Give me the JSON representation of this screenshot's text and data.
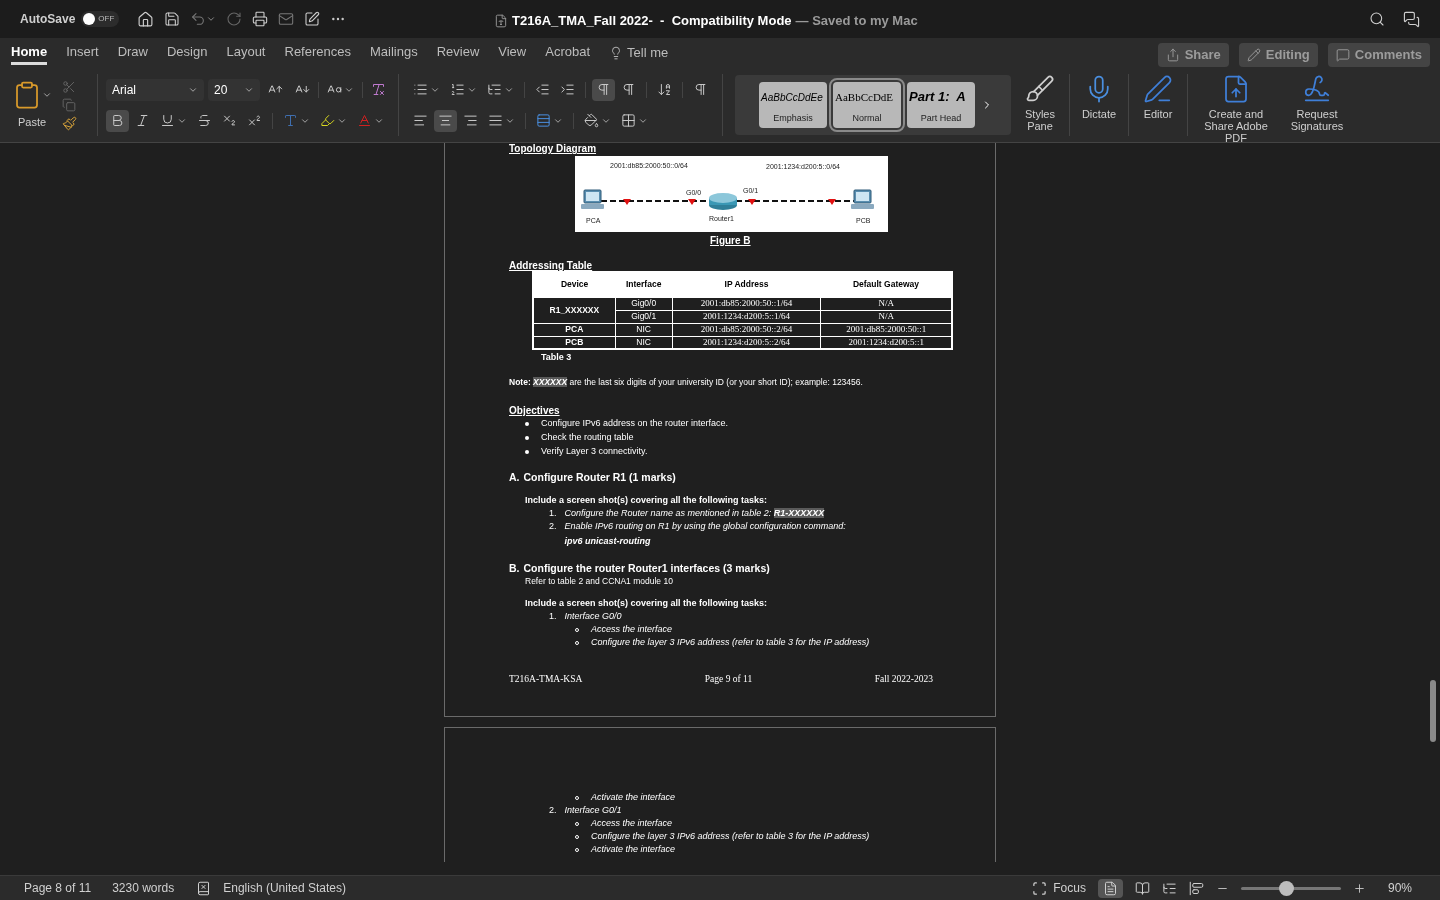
{
  "title_bar": {
    "autosave": {
      "label": "AutoSave",
      "on": false,
      "toggle_text": "OFF"
    },
    "title": "T216A_TMA_Fall 2022-  -  Compatibility Mode",
    "save_status": "— Saved to my Mac"
  },
  "ribbon_tabs": [
    {
      "label": "Home",
      "selected": true
    },
    {
      "label": "Insert",
      "selected": false
    },
    {
      "label": "Draw",
      "selected": false
    },
    {
      "label": "Design",
      "selected": false
    },
    {
      "label": "Layout",
      "selected": false
    },
    {
      "label": "References",
      "selected": false
    },
    {
      "label": "Mailings",
      "selected": false
    },
    {
      "label": "Review",
      "selected": false
    },
    {
      "label": "View",
      "selected": false
    },
    {
      "label": "Acrobat",
      "selected": false
    }
  ],
  "tell_me": "Tell me",
  "header_buttons": [
    "Share",
    "Editing",
    "Comments"
  ],
  "ribbon": {
    "paste_label": "Paste",
    "font_name": "Arial",
    "font_size": "20",
    "format": {
      "bold": true,
      "italic": false,
      "underline": false,
      "strikethrough": false,
      "subscript": false,
      "superscript": false
    },
    "paragraph": {
      "align_left": false,
      "align_center": true,
      "align_right": false,
      "justify": false,
      "ltr": true,
      "show_marks": false
    },
    "styles": [
      {
        "kind": "emphasis",
        "sample": "AaBbCcDdEe",
        "name": "Emphasis",
        "selected": false
      },
      {
        "kind": "normal",
        "sample": "AaBbCcDdE",
        "name": "Normal",
        "selected": true
      },
      {
        "kind": "heading",
        "sample": "Part 1:  A",
        "name": "Part Head",
        "selected": false
      }
    ],
    "tools": [
      {
        "kind": "styles_pane",
        "label": "Styles Pane"
      },
      {
        "kind": "dictate",
        "label": "Dictate"
      },
      {
        "kind": "editor",
        "label": "Editor"
      },
      {
        "kind": "adobe_pdf",
        "label": "Create and Share Adobe PDF"
      },
      {
        "kind": "signatures",
        "label": "Request Signatures"
      }
    ]
  },
  "document": {
    "topology_heading": "Topology Diagram",
    "diagram": {
      "networks": [
        "2001:db85:2000:50::0/64",
        "2001:1234:d200:5::0/64"
      ],
      "interfaces": [
        "G0/0",
        "G0/1"
      ],
      "devices": [
        "PCA",
        "Router1",
        "PCB"
      ]
    },
    "figure_caption": "Figure B",
    "table_heading": "Addressing Table",
    "table": {
      "columns": [
        "Device",
        "Interface",
        "IP Address",
        "Default Gateway"
      ],
      "rows": [
        {
          "device": "R1_XXXXXX",
          "ports": [
            {
              "interface": "Gig0/0",
              "ip": "2001:db85:2000:50::1/64",
              "gateway": "N/A"
            },
            {
              "interface": "Gig0/1",
              "ip": "2001:1234:d200:5::1/64",
              "gateway": "N/A"
            }
          ]
        },
        {
          "device": "PCA",
          "ports": [
            {
              "interface": "NIC",
              "ip": "2001:db85:2000:50::2/64",
              "gateway": "2001:db85:2000:50::1"
            }
          ]
        },
        {
          "device": "PCB",
          "ports": [
            {
              "interface": "NIC",
              "ip": "2001:1234:d200:5::2/64",
              "gateway": "2001:1234:d200:5::1"
            }
          ]
        }
      ]
    },
    "table_caption": "Table 3",
    "note": {
      "label": "Note:",
      "mark": "XXXXXX",
      "text": "are the last six digits of your university ID (or your short ID); example: 123456."
    },
    "objectives": {
      "heading": "Objectives",
      "items": [
        "Configure IPv6 address on the router interface.",
        "Check the routing table",
        "Verify Layer 3 connectivity."
      ]
    },
    "sections": [
      {
        "letter": "A.",
        "title": "Configure Router R1 (1 marks)",
        "intro": "Include a screen shot(s) covering all the following tasks:",
        "tasks": [
          {
            "number": "1.",
            "text": "Configure the Router name as mentioned in table 2:",
            "highlight": "R1-XXXXXX"
          },
          {
            "number": "2.",
            "text": "Enable IPv6 routing on R1 by using the global configuration command:",
            "command": "ipv6 unicast-routing"
          }
        ]
      },
      {
        "letter": "B.",
        "title": "Configure the router Router1 interfaces (3 marks)",
        "subtitle": "Refer to table 2 and CCNA1 module 10",
        "intro": "Include a screen shot(s) covering all the following tasks:",
        "tasks": [
          {
            "number": "1.",
            "text": "Interface G0/0",
            "steps": [
              "Access the interface",
              "Configure the layer 3 IPv6 address (refer to table 3 for the IP address)"
            ]
          }
        ]
      }
    ],
    "footer": [
      "T216A-TMA-KSA",
      "Page 9 of 11",
      "Fall 2022-2023"
    ],
    "next_page": {
      "continued_steps": [
        "Activate the interface"
      ],
      "tasks": [
        {
          "number": "2.",
          "text": "Interface G0/1",
          "steps": [
            "Access the interface",
            "Configure the layer 3 IPv6 address (refer to table 3 for the IP address)",
            "Activate the interface"
          ]
        }
      ]
    }
  },
  "status_bar": {
    "page": "Page 8 of 11",
    "words": "3230 words",
    "language": "English (United States)",
    "focus": "Focus",
    "zoom": {
      "level": 0.45,
      "reading": "90%"
    }
  }
}
